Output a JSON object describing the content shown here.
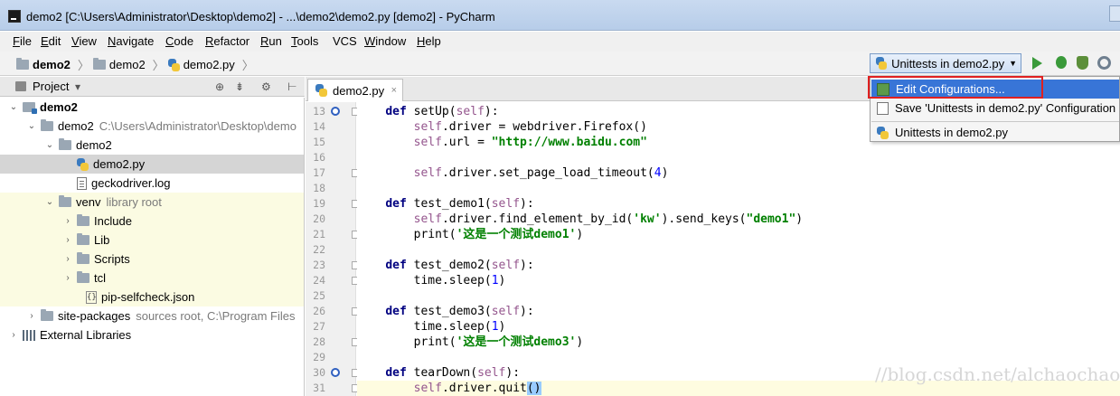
{
  "window": {
    "title": "demo2 [C:\\Users\\Administrator\\Desktop\\demo2] - ...\\demo2\\demo2.py [demo2] - PyCharm"
  },
  "menu": [
    {
      "u": "F",
      "rest": "ile"
    },
    {
      "u": "E",
      "rest": "dit"
    },
    {
      "u": "V",
      "rest": "iew"
    },
    {
      "u": "N",
      "rest": "avigate"
    },
    {
      "u": "C",
      "rest": "ode"
    },
    {
      "u": "R",
      "rest": "efactor"
    },
    {
      "u": "R",
      "rest": "un"
    },
    {
      "u": "T",
      "rest": "ools"
    },
    {
      "u": "VCS",
      "rest": ""
    },
    {
      "u": "W",
      "rest": "indow"
    },
    {
      "u": "H",
      "rest": "elp"
    }
  ],
  "breadcrumb": {
    "root": "demo2",
    "folder": "demo2",
    "file": "demo2.py"
  },
  "run_config": {
    "selected": "Unittests in demo2.py"
  },
  "project_panel": {
    "title": "Project"
  },
  "tree": {
    "root": "demo2",
    "demo2_folder": "demo2",
    "demo2_path": "C:\\Users\\Administrator\\Desktop\\demo",
    "demo2_sub": "demo2",
    "demo2_py": "demo2.py",
    "gecko_log": "geckodriver.log",
    "venv": "venv",
    "venv_hint": "library root",
    "include": "Include",
    "lib": "Lib",
    "scripts": "Scripts",
    "tcl": "tcl",
    "pip_json": "pip-selfcheck.json",
    "site_packages": "site-packages",
    "site_hint": "sources root,  C:\\Program Files",
    "ext_libs": "External Libraries"
  },
  "editor": {
    "tab": "demo2.py",
    "lines": [
      "13",
      "14",
      "15",
      "16",
      "17",
      "18",
      "19",
      "20",
      "21",
      "22",
      "23",
      "24",
      "25",
      "26",
      "27",
      "28",
      "29",
      "30",
      "31"
    ]
  },
  "dropdown": {
    "edit": "Edit Configurations...",
    "save": "Save 'Unittests in demo2.py' Configuration",
    "unittests": "Unittests in demo2.py"
  },
  "watermark": "//blog.csdn.net/alchaochao"
}
